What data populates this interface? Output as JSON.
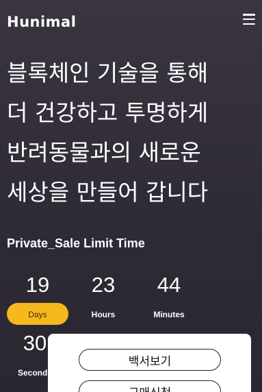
{
  "header": {
    "logo": "Hunimal",
    "menu_icon": "hamburger-icon"
  },
  "hero": {
    "lines": [
      "블록체인 기술을 통해",
      "더 건강하고 투명하게",
      "반려동물과의 새로운",
      "세상을 만들어 갑니다"
    ]
  },
  "sale": {
    "title": "Private_Sale Limit Time"
  },
  "countdown": [
    {
      "value": "19",
      "label": "Days"
    },
    {
      "value": "23",
      "label": "Hours"
    },
    {
      "value": "44",
      "label": "Minutes"
    },
    {
      "value": "30",
      "label": "Seconds"
    }
  ],
  "popup": {
    "whitepaper_button": "백서보기",
    "purchase_button": "구매신청"
  },
  "colors": {
    "accent": "#f6b81d",
    "background": "#322e38"
  }
}
